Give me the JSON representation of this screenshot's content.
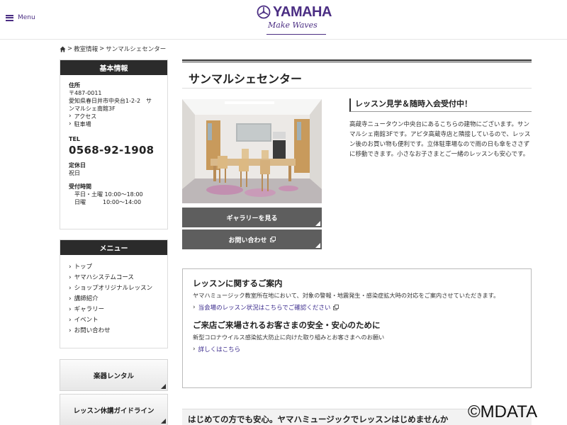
{
  "header": {
    "menu_label": "Menu",
    "logo_text": "YAMAHA",
    "logo_tagline": "Make Waves"
  },
  "breadcrumb": [
    "教室情報",
    "サンマルシェセンター"
  ],
  "sidebar": {
    "info_title": "基本情報",
    "address_label": "住所",
    "postal": "〒487-0011",
    "address_line1": "愛知県春日井市中央台1-2-2　サ",
    "address_line2": "ンマルシェ南館3F",
    "access_link": "アクセス",
    "parking_link": "駐車場",
    "tel_label": "TEL",
    "tel": "0568-92-1908",
    "closed_label": "定休日",
    "closed_value": "祝日",
    "hours_label": "受付時間",
    "hours_weekday": "平日・土曜 10:00～18:00",
    "hours_sunday": "日曜　　　10:00～14:00",
    "menu_title": "メニュー",
    "menu_items": [
      "トップ",
      "ヤマハシステムコース",
      "ショップオリジナルレッスン",
      "講師紹介",
      "ギャラリー",
      "イベント",
      "お問い合わせ"
    ],
    "rental_button": "楽器レンタル",
    "guideline_button": "レッスン休講ガイドライン"
  },
  "main": {
    "title": "サンマルシェセンター",
    "gallery_button": "ギャラリーを見る",
    "contact_button": "お問い合わせ",
    "lesson_heading": "レッスン見学＆随時入会受付中！",
    "lesson_text": "高蔵寺ニュータウン中央台にあるこちらの建物にございます。サンマルシェ南館3Fです。アピタ高蔵寺店と隣接しているので、レッスン後のお買い物も便利です。立体駐車場なので雨の日も傘をささずに移動できます。小さなお子さまとご一緒のレッスンも安心です。"
  },
  "notice": {
    "title1": "レッスンに関するご案内",
    "text1": "ヤマハミュージック教室所在地において、対象の警報・地震発生・感染症拡大時の対応をご案内させていただきます。",
    "link1": "当会場のレッスン状況はこちらでご確認ください",
    "title2": "ご来店ご来場されるお客さまの安全・安心のために",
    "text2": "新型コロナウイルス感染拡大防止に向けた取り組みとお客さまへのお願い",
    "link2": "詳しくはこちら"
  },
  "banner": {
    "text": "はじめての方でも安心。ヤマハミュージックでレッスンはじめませんか"
  },
  "watermark": "©MDATA",
  "colors": {
    "brand": "#4b2e83",
    "dark": "#2b2b2b",
    "button": "#5e5e5e",
    "link": "#3a2a8c"
  }
}
